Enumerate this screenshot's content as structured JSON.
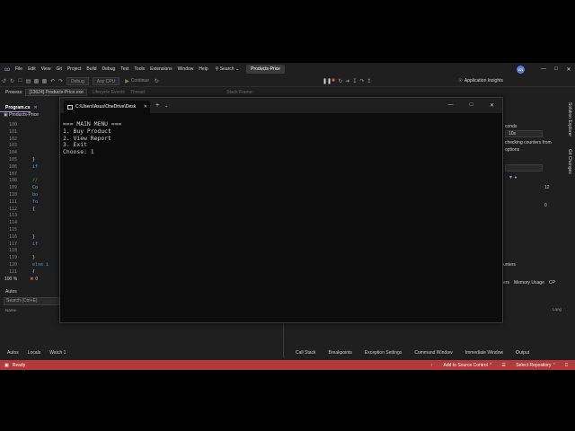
{
  "menubar": {
    "items": [
      "File",
      "Edit",
      "View",
      "Git",
      "Project",
      "Build",
      "Debug",
      "Test",
      "Tools",
      "Extensions",
      "Window",
      "Help"
    ],
    "search": "Search",
    "solution_name": "Products-Price",
    "avatar": "AN"
  },
  "toolbar": {
    "config": "Debug",
    "platform": "Any CPU",
    "continue": "Continue",
    "app_insights": "Application Insights"
  },
  "process_bar": {
    "process_label": "Process:",
    "process_value": "[13624] Products-Price.exe",
    "lifecycle": "Lifecycle Events",
    "thread": "Thread:",
    "stack_frame": "Stack Frame:"
  },
  "editor": {
    "tab": "Program.cs",
    "project": "Products-Price",
    "zoom": "100 %",
    "errors": "0",
    "lines": [
      {
        "n": "100",
        "code": "",
        "cls": ""
      },
      {
        "n": "101",
        "code": "",
        "cls": ""
      },
      {
        "n": "102",
        "code": "",
        "cls": ""
      },
      {
        "n": "103",
        "code": "",
        "cls": ""
      },
      {
        "n": "104",
        "code": "",
        "cls": ""
      },
      {
        "n": "105",
        "code": "}",
        "cls": ""
      },
      {
        "n": "106",
        "code": "if",
        "cls": "kw"
      },
      {
        "n": "107",
        "code": "",
        "cls": ""
      },
      {
        "n": "108",
        "code": "//",
        "cls": "cm"
      },
      {
        "n": "109",
        "code": "Co",
        "cls": "ty"
      },
      {
        "n": "110",
        "code": "bo",
        "cls": "kw"
      },
      {
        "n": "111",
        "code": "fo",
        "cls": "kw"
      },
      {
        "n": "112",
        "code": "{",
        "cls": ""
      },
      {
        "n": "113",
        "code": "",
        "cls": ""
      },
      {
        "n": "114",
        "code": "",
        "cls": ""
      },
      {
        "n": "115",
        "code": "",
        "cls": ""
      },
      {
        "n": "116",
        "code": "}",
        "cls": ""
      },
      {
        "n": "117",
        "code": "if",
        "cls": "kw"
      },
      {
        "n": "118",
        "code": "",
        "cls": ""
      },
      {
        "n": "119",
        "code": "}",
        "cls": ""
      },
      {
        "n": "120",
        "code": "else i",
        "cls": "kw"
      },
      {
        "n": "121",
        "code": "{",
        "cls": ""
      }
    ]
  },
  "autos": {
    "title": "Autos",
    "search_placeholder": "Search (Ctrl+E)",
    "col_name": "Name",
    "tabs": [
      "Autos",
      "Locals",
      "Watch 1"
    ]
  },
  "bottom_right_tabs": [
    "Call Stack",
    "Breakpoints",
    "Exception Settings",
    "Command Window",
    "Immediate Window",
    "Output"
  ],
  "right_panel": {
    "seconds": "conds",
    "interval": "10s",
    "line1": "checking counters from",
    "line2": "options",
    "num1": "12",
    "num2": "0",
    "tab_events": "ers",
    "tab_memory": "Memory Usage",
    "tab_cpu": "CP",
    "counters": "unters",
    "lang": "Lang",
    "vtab1": "Solution Explorer",
    "vtab2": "Git Changes"
  },
  "statusbar": {
    "ready": "Ready",
    "source_control": "Add to Source Control",
    "repository": "Select Repository"
  },
  "console": {
    "title": "C:\\Users\\Asus\\OneDrive\\Desk",
    "lines": [
      "=== MAIN MENU ===",
      "1. Buy Product",
      "2. View Report",
      "3. Exit",
      "Choose: 1"
    ]
  },
  "colors": {
    "statusbar": "#b23a3a",
    "accent": "#a78bfa"
  }
}
